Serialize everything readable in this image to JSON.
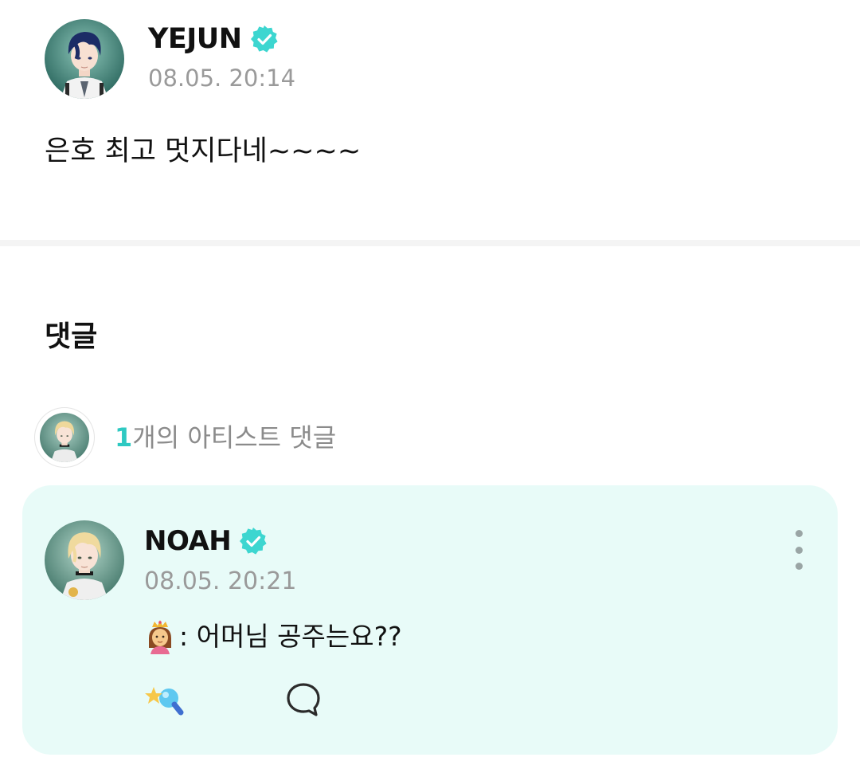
{
  "post": {
    "author": "YEJUN",
    "verified": true,
    "timestamp": "08.05. 20:14",
    "body": "은호 최고 멋지다네~~~~"
  },
  "comments": {
    "title": "댓글",
    "artist_summary": {
      "count": "1",
      "label": "개의 아티스트 댓글"
    },
    "items": [
      {
        "author": "NOAH",
        "verified": true,
        "timestamp": "08.05. 20:21",
        "emoji": "princess-emoji",
        "text": ": 어머님 공주는요??"
      }
    ]
  },
  "colors": {
    "accent": "#2ec9c2",
    "verified_badge": "#3dd6d0",
    "card_background": "#e8fbf8",
    "muted_text": "#9a9a9a"
  },
  "icons": {
    "verified": "verified-badge-icon",
    "more": "more-vertical-icon",
    "reaction": "star-wand-reaction-icon",
    "reply": "speech-bubble-icon"
  }
}
